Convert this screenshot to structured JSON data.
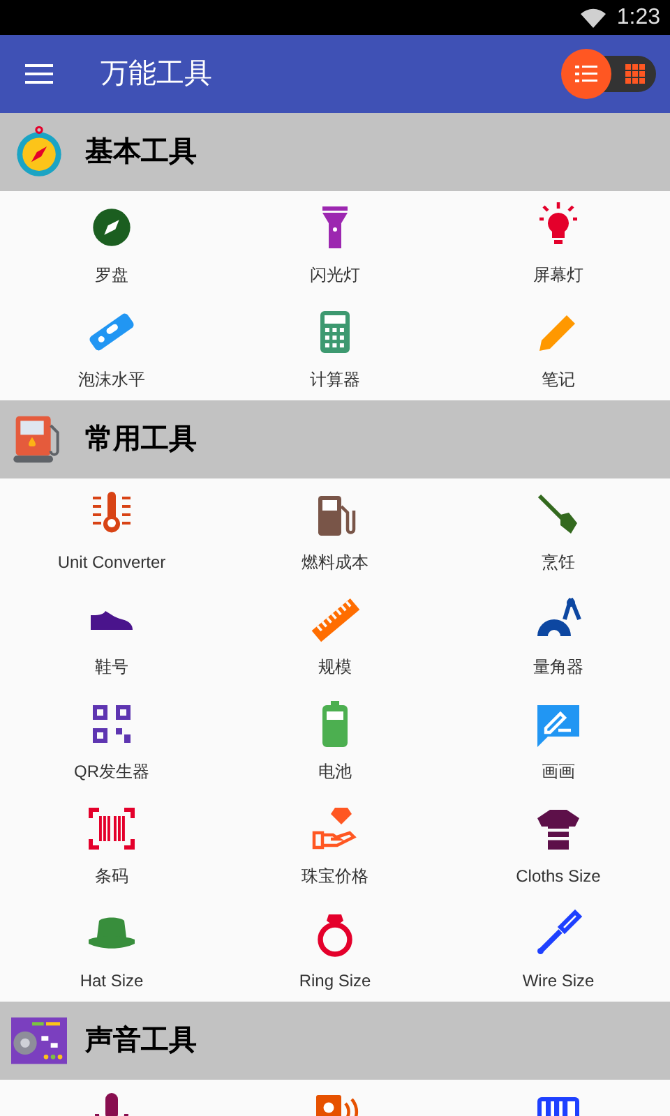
{
  "status_bar": {
    "time": "1:23"
  },
  "app_bar": {
    "title": "万能工具",
    "view_toggle": [
      {
        "kind": "list",
        "selected": true
      },
      {
        "kind": "grid",
        "selected": false
      }
    ]
  },
  "sections": [
    {
      "title": "基本工具",
      "items": [
        {
          "kind": "tool",
          "label": "罗盘"
        },
        {
          "kind": "tool",
          "label": "闪光灯"
        },
        {
          "kind": "tool",
          "label": "屏幕灯"
        },
        {
          "kind": "tool",
          "label": "泡沫水平"
        },
        {
          "kind": "tool",
          "label": "计算器"
        },
        {
          "kind": "tool",
          "label": "笔记"
        }
      ]
    },
    {
      "title": "常用工具",
      "items": [
        {
          "kind": "tool",
          "label": "Unit Converter"
        },
        {
          "kind": "tool",
          "label": "燃料成本"
        },
        {
          "kind": "tool",
          "label": "烹饪"
        },
        {
          "kind": "tool",
          "label": "鞋号"
        },
        {
          "kind": "tool",
          "label": "规模"
        },
        {
          "kind": "tool",
          "label": "量角器"
        },
        {
          "kind": "tool",
          "label": "QR发生器"
        },
        {
          "kind": "tool",
          "label": "电池"
        },
        {
          "kind": "tool",
          "label": "画画"
        },
        {
          "kind": "tool",
          "label": "条码"
        },
        {
          "kind": "tool",
          "label": "珠宝价格"
        },
        {
          "kind": "tool",
          "label": "Cloths Size"
        },
        {
          "kind": "tool",
          "label": "Hat Size"
        },
        {
          "kind": "tool",
          "label": "Ring Size"
        },
        {
          "kind": "tool",
          "label": "Wire Size"
        }
      ]
    },
    {
      "title": "声音工具",
      "items": [
        {
          "kind": "icon_only"
        },
        {
          "kind": "icon_only"
        },
        {
          "kind": "icon_only"
        }
      ]
    }
  ]
}
